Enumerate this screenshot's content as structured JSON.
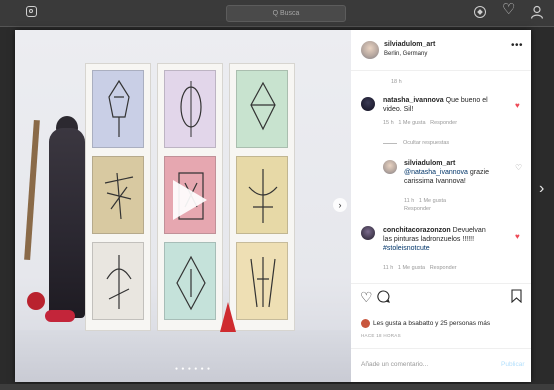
{
  "topbar": {
    "search_placeholder": "Q Busca",
    "icons": [
      "instagram-logo-icon",
      "compass-icon",
      "heart-icon",
      "profile-icon"
    ]
  },
  "post": {
    "username": "silviadulom_art",
    "location": "Berlin, Germany",
    "more": "•••",
    "first_time": "18 h"
  },
  "comments": [
    {
      "username": "natasha_ivannova",
      "text_line1": "Que bueno el",
      "text_line2": "video. Sil!",
      "time": "15 h",
      "likes": "1 Me gusta",
      "reply": "Responder",
      "hide_replies": "Ocultar respuestas",
      "liked": true
    },
    {
      "username": "silviadulom_art",
      "mention": "@natasha_ivannova",
      "text_after_mention": "grazie",
      "text_line3": "carissima Ivannova!",
      "time": "11 h",
      "likes": "1 Me gusta",
      "reply": "Responder",
      "liked": false
    },
    {
      "username": "conchitacorazonzon",
      "text_line1": "Devuelvan",
      "text_line2": "las pinturas ladronzuelos !!!!!!",
      "hashtag": "#stoleisnotcute",
      "time": "11 h",
      "likes": "1 Me gusta",
      "reply": "Responder",
      "liked": true
    }
  ],
  "likes_summary": "Les gusta a bsabatto y 25 personas más",
  "post_time": "HACE 18 HORAS",
  "add_comment_placeholder": "Añade un comentario...",
  "publish_label": "Publicar",
  "video": {
    "prev_arrow": "‹",
    "next_arrow": "›",
    "inner_next": "›",
    "carousel_dots": "● ● ● ● ● ●"
  },
  "colors": {
    "like_red": "#ed4956",
    "link_blue": "#003569",
    "publish_blue": "#b2dffc"
  }
}
